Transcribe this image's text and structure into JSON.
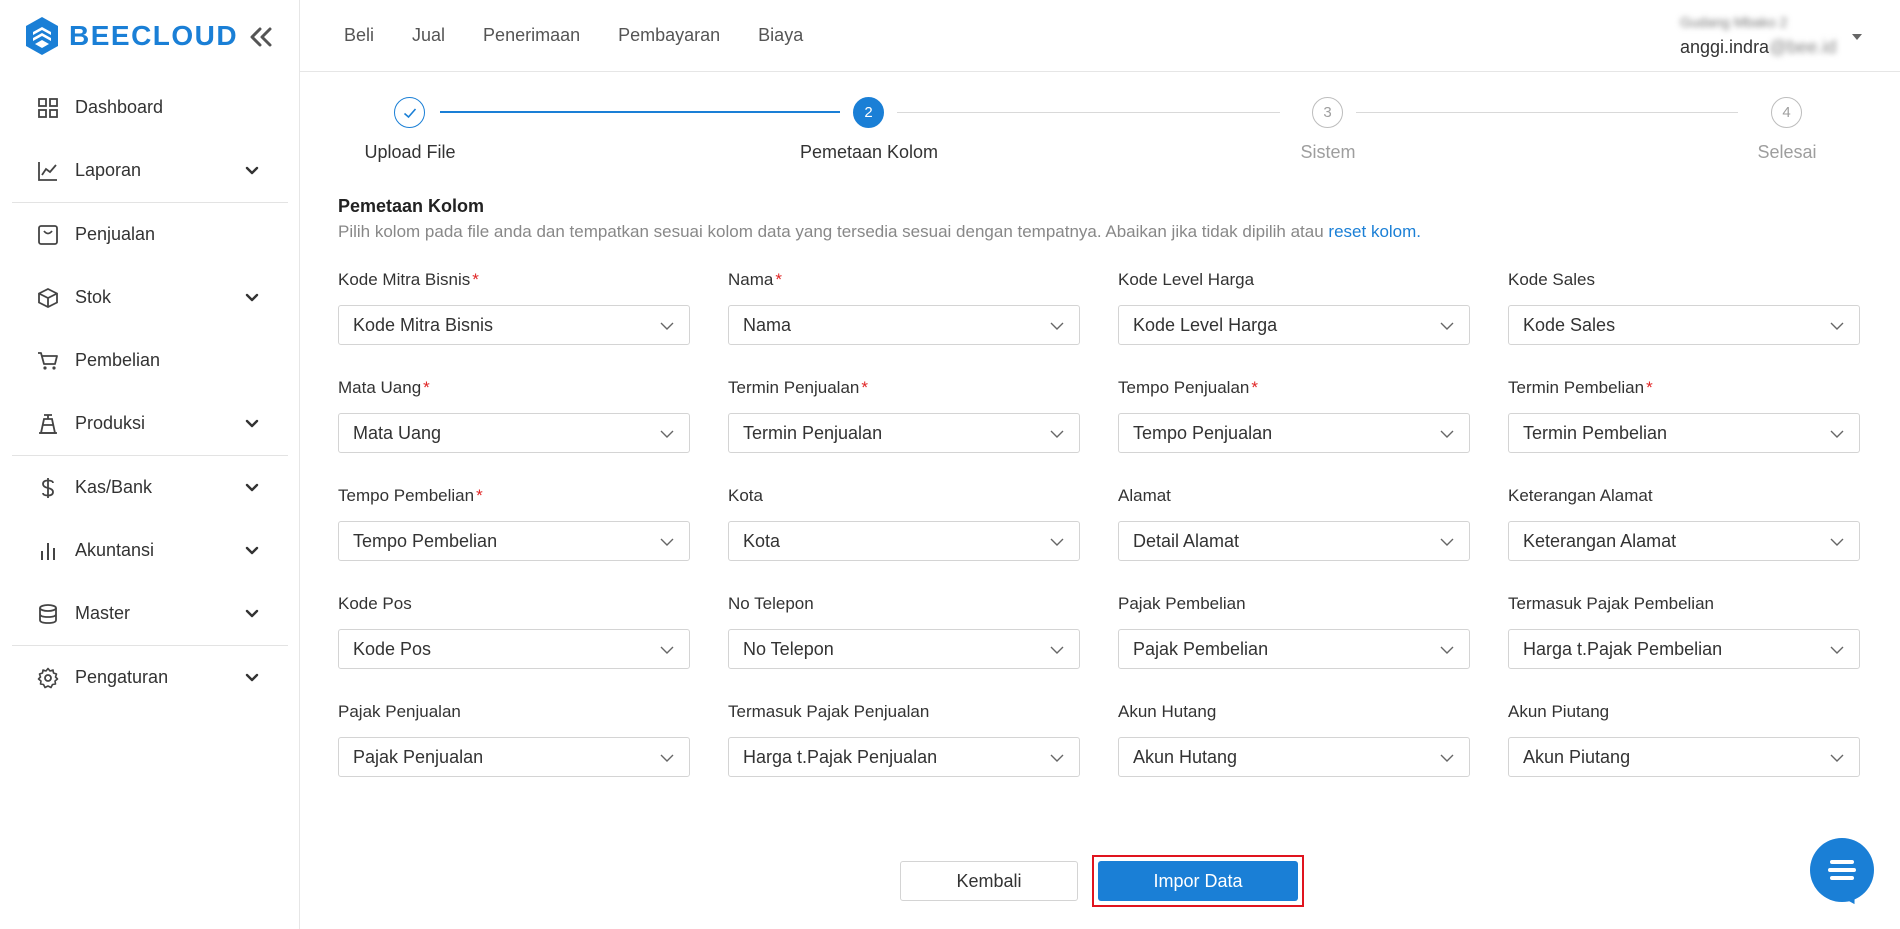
{
  "brand": {
    "name": "BEECLOUD",
    "color": "#1a7fd6"
  },
  "sidebar": {
    "items": [
      {
        "label": "Dashboard",
        "icon": "dashboard-grid-icon",
        "has_chevron": false
      },
      {
        "label": "Laporan",
        "icon": "line-chart-icon",
        "has_chevron": true
      },
      {
        "label": "Penjualan",
        "icon": "sales-box-icon",
        "has_chevron": false
      },
      {
        "label": "Stok",
        "icon": "cube-icon",
        "has_chevron": true
      },
      {
        "label": "Pembelian",
        "icon": "cart-icon",
        "has_chevron": false
      },
      {
        "label": "Produksi",
        "icon": "factory-icon",
        "has_chevron": true
      },
      {
        "label": "Kas/Bank",
        "icon": "dollar-icon",
        "has_chevron": true
      },
      {
        "label": "Akuntansi",
        "icon": "bar-chart-icon",
        "has_chevron": true
      },
      {
        "label": "Master",
        "icon": "database-icon",
        "has_chevron": true
      },
      {
        "label": "Pengaturan",
        "icon": "gear-icon",
        "has_chevron": true
      }
    ]
  },
  "topbar": {
    "menu": [
      "Beli",
      "Jual",
      "Penerimaan",
      "Pembayaran",
      "Biaya"
    ],
    "user": {
      "company": "Gudang Mbako 2",
      "email_prefix": "anggi.indra",
      "email_suffix": "@bee.id"
    }
  },
  "stepper": {
    "steps": [
      {
        "number": "1",
        "label": "Upload File",
        "state": "done"
      },
      {
        "number": "2",
        "label": "Pemetaan Kolom",
        "state": "active"
      },
      {
        "number": "3",
        "label": "Sistem",
        "state": "pending"
      },
      {
        "number": "4",
        "label": "Selesai",
        "state": "pending"
      }
    ]
  },
  "section": {
    "title": "Pemetaan Kolom",
    "description": "Pilih kolom pada file anda dan tempatkan sesuai kolom data yang tersedia sesuai dengan tempatnya. Abaikan jika tidak dipilih atau",
    "reset_link": "reset kolom",
    "period": "."
  },
  "fields": [
    {
      "label": "Kode Mitra Bisnis",
      "required": "*",
      "value": "Kode Mitra Bisnis"
    },
    {
      "label": "Nama",
      "required": "*",
      "value": "Nama"
    },
    {
      "label": "Kode Level Harga",
      "required": "",
      "value": "Kode Level Harga"
    },
    {
      "label": "Kode Sales",
      "required": "",
      "value": "Kode Sales"
    },
    {
      "label": "Mata Uang",
      "required": "*",
      "value": "Mata Uang"
    },
    {
      "label": "Termin Penjualan",
      "required": "*",
      "value": "Termin Penjualan"
    },
    {
      "label": "Tempo Penjualan",
      "required": "*",
      "value": "Tempo Penjualan"
    },
    {
      "label": "Termin Pembelian",
      "required": "*",
      "value": "Termin Pembelian"
    },
    {
      "label": "Tempo Pembelian",
      "required": "*",
      "value": "Tempo Pembelian"
    },
    {
      "label": "Kota",
      "required": "",
      "value": "Kota"
    },
    {
      "label": "Alamat",
      "required": "",
      "value": "Detail Alamat"
    },
    {
      "label": "Keterangan Alamat",
      "required": "",
      "value": "Keterangan Alamat"
    },
    {
      "label": "Kode Pos",
      "required": "",
      "value": "Kode Pos"
    },
    {
      "label": "No Telepon",
      "required": "",
      "value": "No Telepon"
    },
    {
      "label": "Pajak Pembelian",
      "required": "",
      "value": "Pajak Pembelian"
    },
    {
      "label": "Termasuk Pajak Pembelian",
      "required": "",
      "value": "Harga t.Pajak Pembelian"
    },
    {
      "label": "Pajak Penjualan",
      "required": "",
      "value": "Pajak Penjualan"
    },
    {
      "label": "Termasuk Pajak Penjualan",
      "required": "",
      "value": "Harga t.Pajak Penjualan"
    },
    {
      "label": "Akun Hutang",
      "required": "",
      "value": "Akun Hutang"
    },
    {
      "label": "Akun Piutang",
      "required": "",
      "value": "Akun Piutang"
    }
  ],
  "actions": {
    "back_label": "Kembali",
    "import_label": "Impor Data"
  },
  "chat": {
    "icon": "chat-bubble-icon"
  },
  "colors": {
    "accent": "#1a7fd6",
    "required": "#e02424",
    "highlight_border": "#e0141e"
  }
}
